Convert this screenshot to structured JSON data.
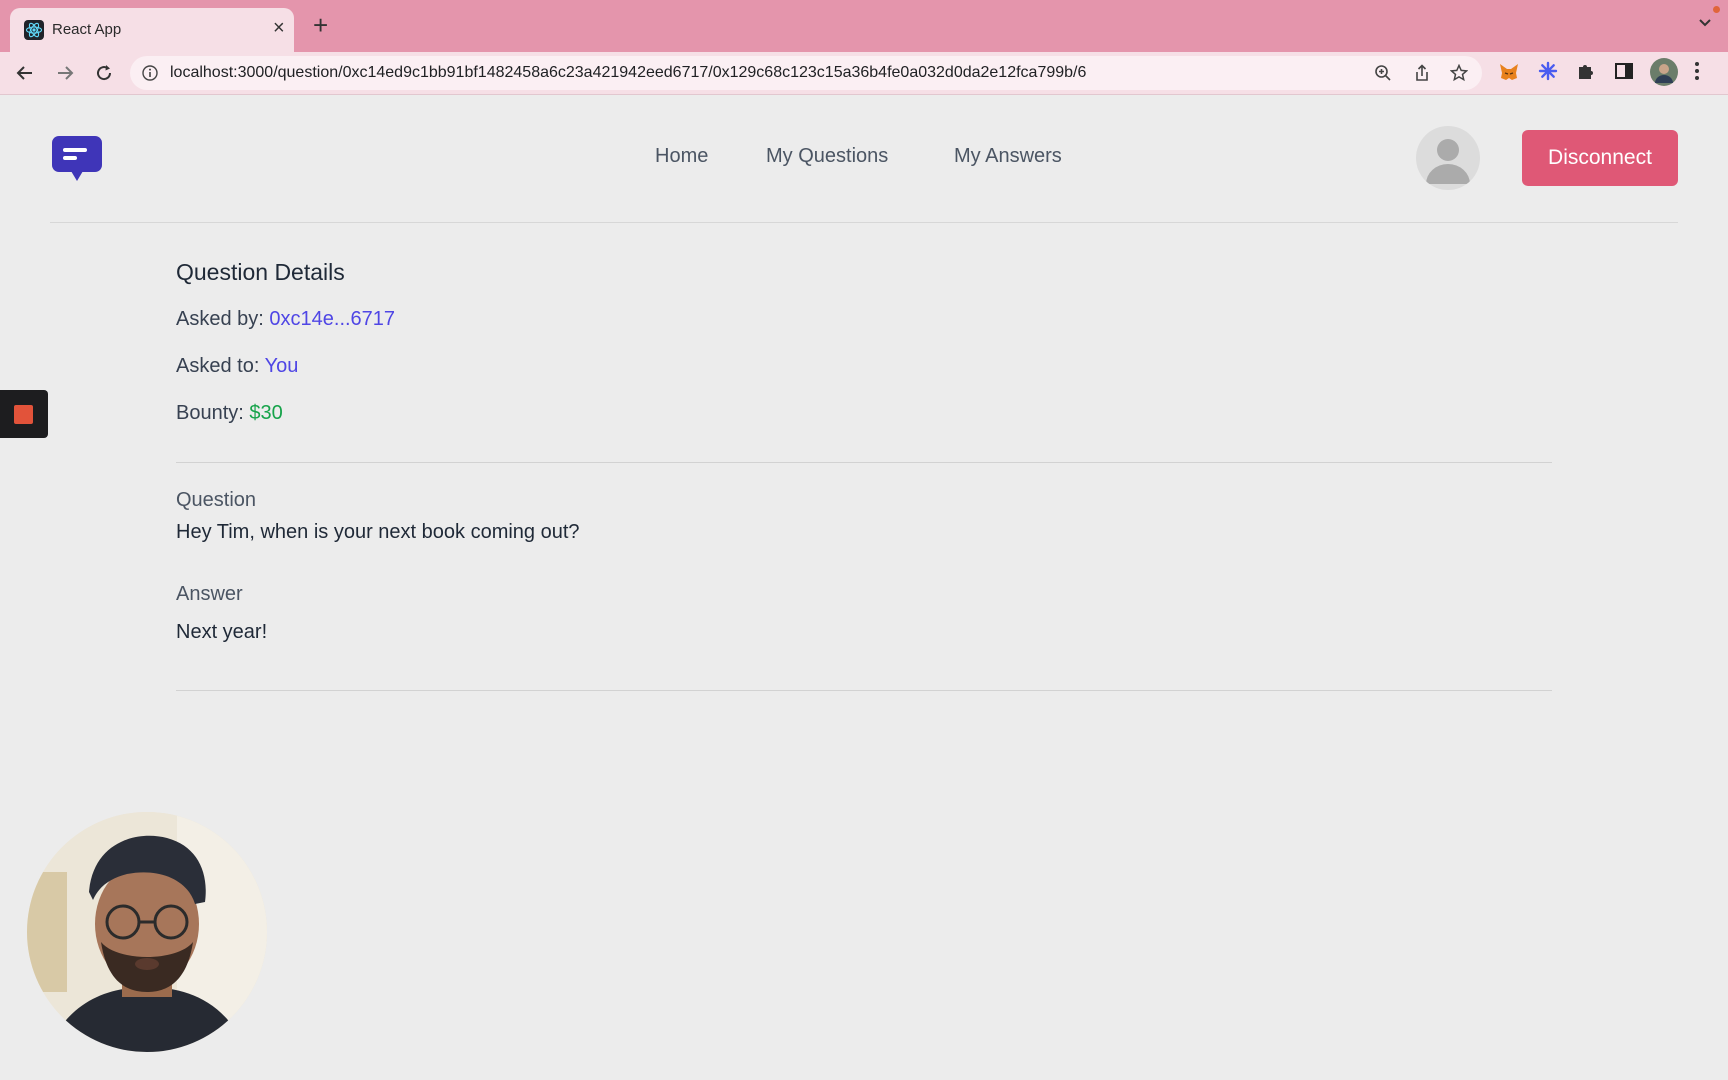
{
  "browser": {
    "tab_title": "React App",
    "url": "localhost:3000/question/0xc14ed9c1bb91bf1482458a6c23a421942eed6717/0x129c68c123c15a36b4fe0a032d0da2e12fca799b/6"
  },
  "nav": {
    "home": "Home",
    "my_questions": "My Questions",
    "my_answers": "My Answers",
    "disconnect": "Disconnect"
  },
  "details": {
    "title": "Question Details",
    "asked_by_label": "Asked by:",
    "asked_by_value": "0xc14e...6717",
    "asked_to_label": "Asked to:",
    "asked_to_value": "You",
    "bounty_label": "Bounty:",
    "bounty_value": "$30",
    "question_label": "Question",
    "question_text": "Hey Tim, when is your next book coming out?",
    "answer_label": "Answer",
    "answer_text": "Next year!"
  },
  "colors": {
    "tabbar": "#e495ac",
    "accent_purple": "#4f46e5",
    "bounty_green": "#16a34a",
    "disconnect_button": "#df5876"
  },
  "icons": [
    "react-favicon",
    "close-icon",
    "plus-icon",
    "chevron-down-icon",
    "back-icon",
    "forward-icon",
    "reload-icon",
    "info-icon",
    "zoom-icon",
    "share-icon",
    "star-icon",
    "metamask-icon",
    "extension-icon",
    "puzzle-icon",
    "sidepanel-icon",
    "profile-icon",
    "menu-icon",
    "chat-logo-icon",
    "avatar-icon",
    "stop-recording-icon"
  ]
}
